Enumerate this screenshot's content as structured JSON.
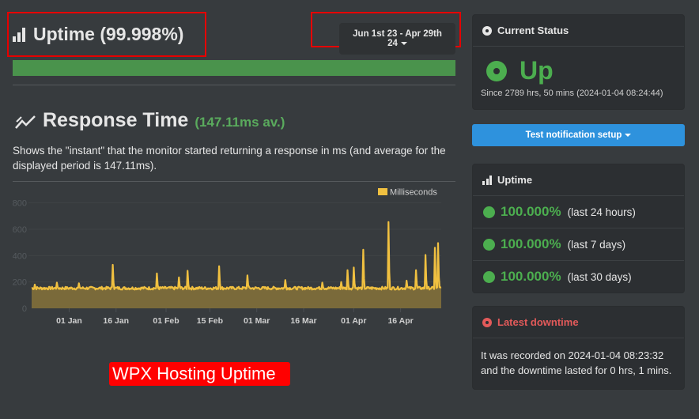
{
  "header": {
    "uptime_title": "Uptime (99.998%)",
    "date_range": "Jun 1st 23 - Apr 29th 24",
    "uptime_percent": 99.998
  },
  "response_time": {
    "title": "Response Time",
    "average": "(147.11ms av.)",
    "description": "Shows the \"instant\" that the monitor started returning a response in ms (and average for the displayed period is 147.11ms)."
  },
  "chart_data": {
    "type": "area",
    "title": "",
    "xlabel": "",
    "ylabel": "",
    "legend": [
      {
        "label": "Milliseconds",
        "color": "#f0c040"
      }
    ],
    "legend_position": "top-right",
    "ylim": [
      0,
      900
    ],
    "yticks": [
      0,
      200,
      400,
      600,
      800
    ],
    "xticks": [
      "01 Jan",
      "16 Jan",
      "01 Feb",
      "15 Feb",
      "01 Mar",
      "16 Mar",
      "01 Apr",
      "16 Apr"
    ],
    "x_range": [
      "2023-12-20",
      "2024-04-29"
    ],
    "baseline_ms": 150,
    "spikes": [
      {
        "date": "2023-12-21",
        "value": 180
      },
      {
        "date": "2023-12-28",
        "value": 195
      },
      {
        "date": "2024-01-04",
        "value": 190
      },
      {
        "date": "2024-01-15",
        "value": 330
      },
      {
        "date": "2024-01-29",
        "value": 265
      },
      {
        "date": "2024-02-05",
        "value": 235
      },
      {
        "date": "2024-02-08",
        "value": 285
      },
      {
        "date": "2024-02-18",
        "value": 320
      },
      {
        "date": "2024-02-27",
        "value": 250
      },
      {
        "date": "2024-03-10",
        "value": 215
      },
      {
        "date": "2024-03-22",
        "value": 195
      },
      {
        "date": "2024-03-28",
        "value": 200
      },
      {
        "date": "2024-03-30",
        "value": 290
      },
      {
        "date": "2024-04-01",
        "value": 310
      },
      {
        "date": "2024-04-04",
        "value": 445
      },
      {
        "date": "2024-04-12",
        "value": 655
      },
      {
        "date": "2024-04-18",
        "value": 210
      },
      {
        "date": "2024-04-21",
        "value": 290
      },
      {
        "date": "2024-04-24",
        "value": 405
      },
      {
        "date": "2024-04-27",
        "value": 460
      },
      {
        "date": "2024-04-28",
        "value": 495
      }
    ]
  },
  "sidebar": {
    "current_status": {
      "title": "Current Status",
      "state": "Up",
      "since": "Since 2789 hrs, 50 mins (2024-01-04 08:24:44)"
    },
    "test_button": "Test notification setup",
    "uptime": {
      "title": "Uptime",
      "rows": [
        {
          "percent": "100.000%",
          "period": "(last 24 hours)"
        },
        {
          "percent": "100.000%",
          "period": "(last 7 days)"
        },
        {
          "percent": "100.000%",
          "period": "(last 30 days)"
        }
      ]
    },
    "latest_downtime": {
      "title": "Latest downtime",
      "text": "It was recorded on 2024-01-04 08:23:32 and the downtime lasted for 0 hrs, 1 mins."
    }
  },
  "annotation": {
    "label": "WPX Hosting Uptime"
  },
  "colors": {
    "accent_green": "#4cae4f",
    "accent_blue": "#2e92dd",
    "downtime_red": "#e35a5a",
    "chart_line": "#f0c040",
    "chart_fill": "#7a6a3a",
    "highlight_red": "#e60000"
  }
}
